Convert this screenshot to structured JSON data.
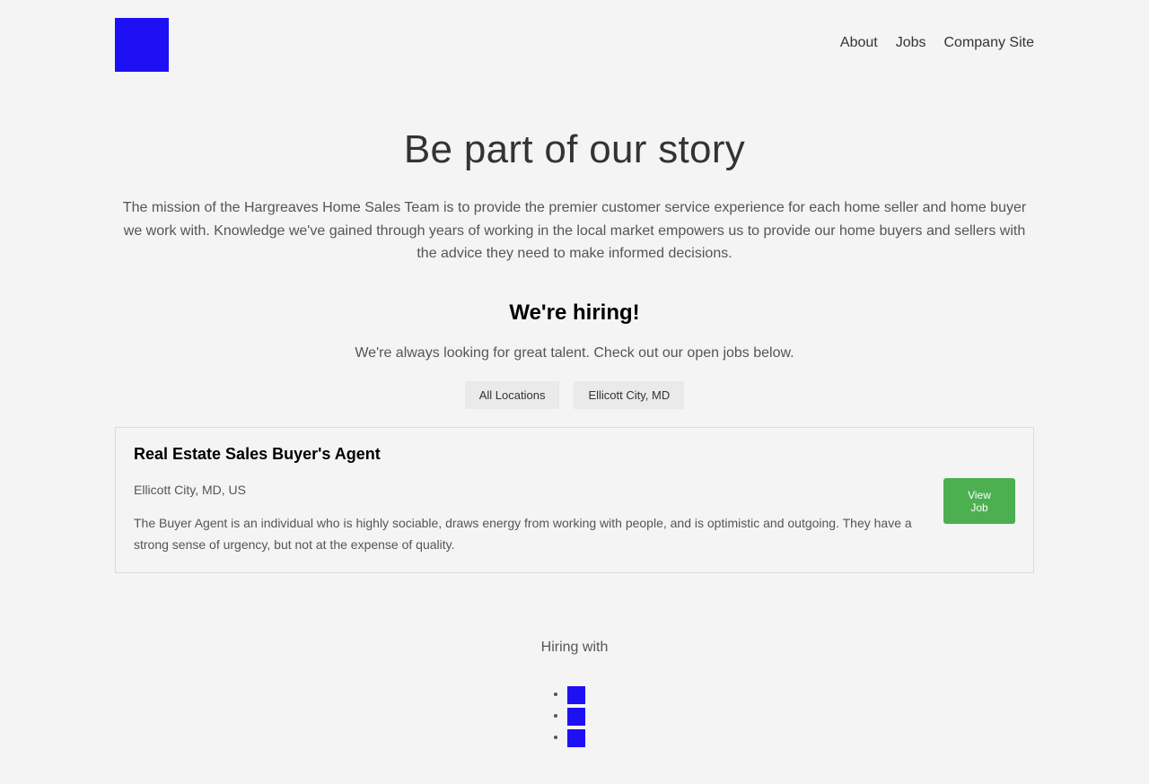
{
  "header": {
    "nav": [
      "About",
      "Jobs",
      "Company Site"
    ]
  },
  "hero": {
    "title": "Be part of our story",
    "mission": "The mission of the Hargreaves Home Sales Team is to provide the premier customer service experience for each home seller and home buyer we work with. Knowledge we've gained through years of working in the local market empowers us to provide our home buyers and sellers with the advice they need to make informed decisions."
  },
  "hiring": {
    "title": "We're hiring!",
    "subtitle": "We're always looking for great talent. Check out our open jobs below.",
    "filters": [
      "All Locations",
      "Ellicott City, MD"
    ]
  },
  "jobs": [
    {
      "title": "Real Estate Sales Buyer's Agent",
      "location": "Ellicott City, MD, US",
      "description": "The Buyer Agent is an individual who is highly sociable, draws energy from working with people, and is optimistic and outgoing. They have a strong sense of urgency, but not at the expense of quality.",
      "button": "View Job"
    }
  ],
  "footer": {
    "hiring_with": "Hiring with"
  },
  "colors": {
    "logo": "#1e10f5",
    "view_button": "#4caf50"
  }
}
